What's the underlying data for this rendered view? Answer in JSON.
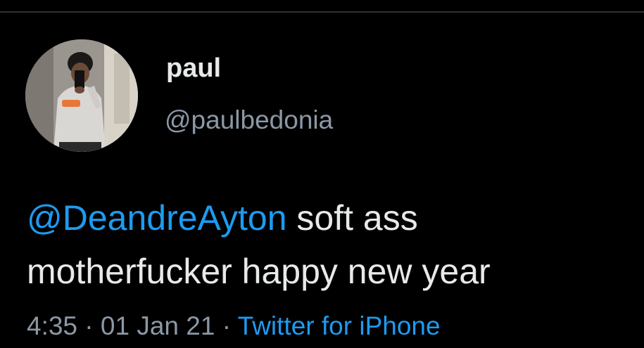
{
  "tweet": {
    "author": {
      "display_name": "paul",
      "handle": "@paulbedonia"
    },
    "mention": "@DeandreAyton",
    "text_line1_rest": " soft ass",
    "text_line2": "motherfucker happy new year",
    "meta": {
      "time": "4:35",
      "separator1": " · ",
      "date": "01 Jan 21",
      "separator2": " · ",
      "source": "Twitter for iPhone"
    }
  },
  "colors": {
    "background": "#000000",
    "text": "#e7e9ea",
    "secondary_text": "#8b98a5",
    "link": "#1d9bf0",
    "divider": "#2f3336"
  },
  "icons": {
    "avatar": "profile-photo-mirror-selfie"
  }
}
